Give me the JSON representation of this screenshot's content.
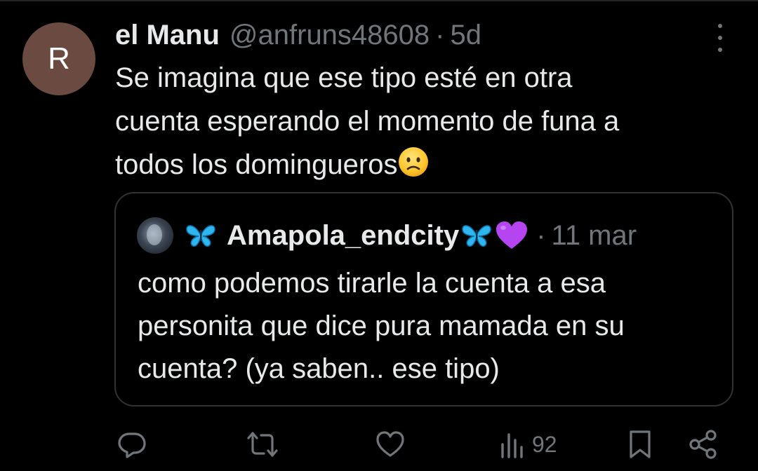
{
  "tweet": {
    "avatar_letter": "R",
    "display_name": "el Manu",
    "handle": "@anfruns48608",
    "separator": "·",
    "time": "5d",
    "text_lines": [
      "Se imagina que ese tipo esté en otra",
      "cuenta esperando el momento de funa a",
      "todos los domingueros"
    ],
    "emoji": "worried-face-emoji"
  },
  "quote": {
    "display_name": "Amapola_endcity",
    "name_decorations": [
      "blue-butterfly-emoji",
      "blue-butterfly-emoji",
      "purple-heart-emoji"
    ],
    "separator": "·",
    "time": "11 mar",
    "text_lines": [
      "como podemos tirarle la cuenta a esa",
      "personita que dice pura mamada en su",
      "cuenta? (ya saben.. ese tipo)"
    ]
  },
  "actions": {
    "reply_icon": "reply-icon",
    "retweet_icon": "retweet-icon",
    "like_icon": "like-icon",
    "views_icon": "views-icon",
    "views_count": "92",
    "bookmark_icon": "bookmark-icon",
    "share_icon": "share-icon"
  },
  "colors": {
    "background": "#000000",
    "text_primary": "#e7e9ea",
    "text_secondary": "#71767b",
    "border": "#2f3336",
    "avatar_bg": "#6b4a41"
  }
}
